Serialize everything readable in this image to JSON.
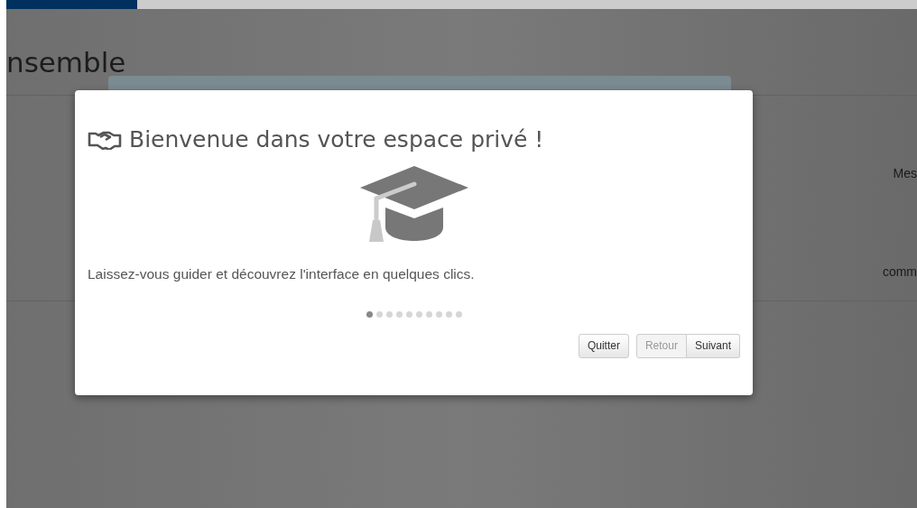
{
  "page": {
    "heading": "nsemble",
    "side_texts": [
      "Mes",
      "comm"
    ]
  },
  "tour": {
    "title": "Bienvenue dans votre espace privé !",
    "text": "Laissez-vous guider et découvrez l'interface en quelques clics.",
    "steps": [
      {
        "selected": true
      },
      {
        "selected": false
      },
      {
        "selected": false
      },
      {
        "selected": false
      },
      {
        "selected": false
      },
      {
        "selected": false
      },
      {
        "selected": false
      },
      {
        "selected": false
      },
      {
        "selected": false
      },
      {
        "selected": false
      }
    ],
    "buttons": [
      {
        "label": "Quitter",
        "disabled": false,
        "group": false
      },
      {
        "label": "Retour",
        "disabled": true,
        "group": true
      },
      {
        "label": "Suivant",
        "disabled": false,
        "group": true
      }
    ]
  }
}
